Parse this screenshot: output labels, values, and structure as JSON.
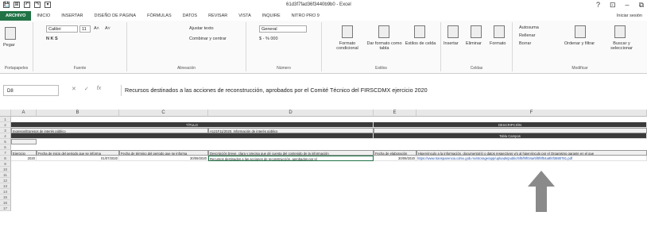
{
  "window": {
    "title": "61d3f7fad36f3440b9b0 - Excel",
    "controls": [
      "?",
      "⊡",
      "–",
      "⧉"
    ]
  },
  "quick_access": [
    "💾",
    "⊞",
    "↶",
    "↷",
    "▾"
  ],
  "tabs": [
    "ARCHIVO",
    "INICIO",
    "INSERTAR",
    "DISEÑO DE PÁGINA",
    "FÓRMULAS",
    "DATOS",
    "REVISAR",
    "VISTA",
    "INQUIRE",
    "NITRO PRO 9"
  ],
  "signin": "Iniciar sesión",
  "ribbon": {
    "clipboard": {
      "paste": "Pegar",
      "label": "Portapapeles"
    },
    "font": {
      "name": "Calibri",
      "size": "11",
      "grow": "A˄",
      "shrink": "A˅",
      "styles": "N  K  S",
      "label": "Fuente"
    },
    "alignment": {
      "wrap": "Ajustar texto",
      "merge": "Combinar y centrar",
      "label": "Alineación"
    },
    "number": {
      "format": "General",
      "symbols": "$ - % 000",
      "label": "Número"
    },
    "styles": {
      "conditional": "Formato condicional",
      "table": "Dar formato como tabla",
      "cell": "Estilos de celda",
      "label": "Estilos"
    },
    "cells": {
      "insert": "Insertar",
      "delete": "Eliminar",
      "format": "Formato",
      "label": "Celdas"
    },
    "editing": {
      "autosum": "Autosuma",
      "fill": "Rellenar",
      "clear": "Borrar",
      "sort": "Ordenar y filtrar",
      "find": "Buscar y seleccionar",
      "label": "Modificar"
    }
  },
  "formula_bar": {
    "namebox": "D8",
    "formula": "Recursos destinados a las acciones de reconstrucción, aprobados por el Comité Técnico del FIRSCDMX ejercicio 2020"
  },
  "columns": [
    "A",
    "B",
    "C",
    "D",
    "E",
    "F"
  ],
  "rows": [
    "1",
    "2",
    "3",
    "4",
    "5",
    "6",
    "7",
    "8",
    "9",
    "10",
    "11",
    "12",
    "13",
    "14",
    "15",
    "16",
    "17"
  ],
  "sheet": {
    "r2_left": "TÍTULO",
    "r2_right": "DESCRIPCIÓN",
    "r3_a": "Ingresos/Egresos de interés público",
    "r3_d": "A121F11/2020. Información de interés público",
    "r4_right": "Tabla Campos",
    "r7": [
      "Ejercicio",
      "Fecha de inicio del periodo que se informa",
      "Fecha de término del periodo que se informa",
      "Descripción breve, clara y precisa que dé cuenta del contenido de la información",
      "Fecha de elaboración",
      "Hipervínculo a la información, documento(s) o datos respectivos y/o al hipervínculo por el Organismo garante en el que"
    ],
    "r8": [
      "2020",
      "01/07/2020",
      "30/09/2020",
      "Recursos destinados a las acciones de reconstrucción, aprobados por el",
      "30/09/2020",
      "https://www.transparencia.cdmx.gob.mx/storage/app/uploads/public/5f0/f8f/04a/5f0f8f04a8f4f3880781.pdf"
    ]
  },
  "colors": {
    "file_tab": "#217346",
    "dark_band": "#3a3a3a",
    "arrow": "#8a8a8a"
  }
}
